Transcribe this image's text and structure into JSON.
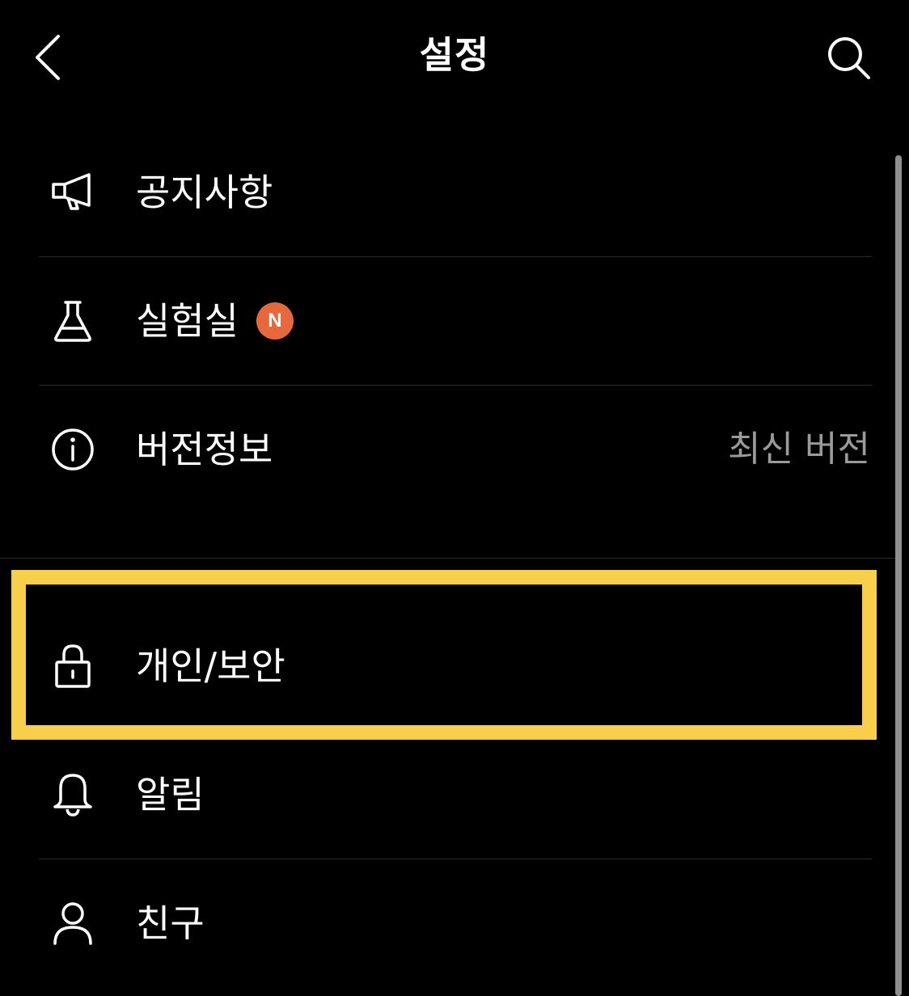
{
  "header": {
    "title": "설정",
    "back_icon": "chevron-left-icon",
    "search_icon": "search-icon"
  },
  "menu": {
    "items": [
      {
        "label": "공지사항",
        "icon": "megaphone-icon"
      },
      {
        "label": "실험실",
        "icon": "flask-icon",
        "badge": "N"
      },
      {
        "label": "버전정보",
        "icon": "info-icon",
        "value": "최신 버전"
      },
      {
        "label": "개인/보안",
        "icon": "lock-icon",
        "highlighted": true
      },
      {
        "label": "알림",
        "icon": "bell-icon"
      },
      {
        "label": "친구",
        "icon": "person-icon"
      }
    ]
  },
  "colors": {
    "background": "#000000",
    "text": "#ffffff",
    "value_text": "#9a9a9a",
    "badge": "#e8683d",
    "highlight": "#f7cf4a",
    "divider": "#2a2a2a"
  }
}
